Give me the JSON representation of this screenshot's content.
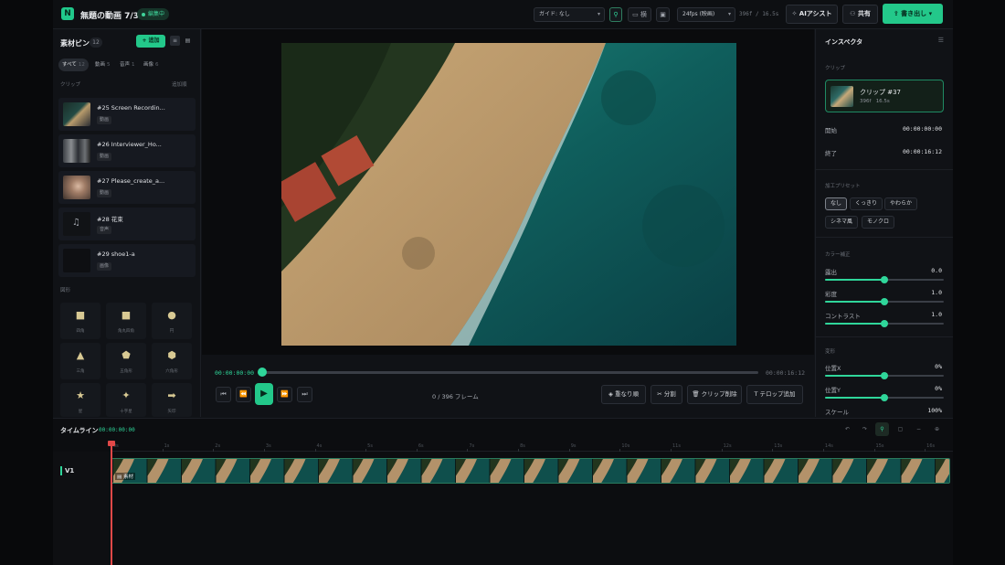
{
  "project": {
    "logo": "N",
    "title": "無題の動画 7/31",
    "status": "編集中"
  },
  "toolbar": {
    "guide_select": "ガイド: なし",
    "aspect_label": "横",
    "fps_select": "24fps (映画)",
    "frames_info": "396f / 16.5s",
    "ai_label": "AIアシスト",
    "share_label": "共有",
    "export_label": "書き出し"
  },
  "bin": {
    "title": "素材ビン",
    "count": "12",
    "add_label": "+ 追加",
    "tabs": [
      {
        "label": "すべて",
        "count": "12"
      },
      {
        "label": "動画",
        "count": "5"
      },
      {
        "label": "音声",
        "count": "1"
      },
      {
        "label": "画像",
        "count": "6"
      }
    ],
    "clips_label": "クリップ",
    "sort_label": "追加順",
    "clips": [
      {
        "name": "#25 Screen Recordin...",
        "type": "動画"
      },
      {
        "name": "#26 Interviewer_Ho...",
        "type": "動画"
      },
      {
        "name": "#27 Please_create_a...",
        "type": "動画"
      },
      {
        "name": "#28 花束",
        "type": "音声"
      },
      {
        "name": "#29 shoe1-a",
        "type": "画像"
      }
    ],
    "shapes_label": "図形",
    "shapes": [
      {
        "label": "四角",
        "icon": "square-icon"
      },
      {
        "label": "角丸四角",
        "icon": "rounded-square-icon"
      },
      {
        "label": "円",
        "icon": "circle-icon"
      },
      {
        "label": "三角",
        "icon": "triangle-icon"
      },
      {
        "label": "五角形",
        "icon": "pentagon-icon"
      },
      {
        "label": "六角形",
        "icon": "hexagon-icon"
      },
      {
        "label": "星",
        "icon": "star-icon"
      },
      {
        "label": "十字星",
        "icon": "sparkle-icon"
      },
      {
        "label": "矢印",
        "icon": "arrow-right-icon"
      }
    ]
  },
  "transport": {
    "current_tc": "00:00:00:00",
    "end_tc": "00:00:16:12",
    "frame_count": "0 / 396 フレーム",
    "overlap_label": "重なり順",
    "split_label": "分割",
    "delete_label": "クリップ削除",
    "caption_label": "テロップ追加"
  },
  "inspector": {
    "title": "インスペクタ",
    "clip_section": "クリップ",
    "clip_name": "クリップ #37",
    "clip_frames": "396f",
    "clip_duration": "16.5s",
    "start_label": "開始",
    "start_value": "00:00:00:00",
    "end_label": "終了",
    "end_value": "00:00:16:12",
    "preset_section": "加工プリセット",
    "presets": [
      "なし",
      "くっきり",
      "やわらか",
      "シネマ風",
      "モノクロ"
    ],
    "color_section": "カラー補正",
    "sliders": [
      {
        "label": "露出",
        "value": "0.0",
        "level": 0.5
      },
      {
        "label": "彩度",
        "value": "1.0",
        "level": 0.5
      },
      {
        "label": "コントラスト",
        "value": "1.0",
        "level": 0.5
      }
    ],
    "transform_section": "変形",
    "transform": [
      {
        "label": "位置X",
        "value": "0%",
        "level": 0.5
      },
      {
        "label": "位置Y",
        "value": "0%",
        "level": 0.5
      }
    ],
    "scale_label": "スケール",
    "scale_value": "100%"
  },
  "timeline": {
    "title": "タイムライン",
    "current_tc": "00:00:00:00",
    "ticks": [
      "0s",
      "1s",
      "2s",
      "3s",
      "4s",
      "5s",
      "6s",
      "7s",
      "8s",
      "9s",
      "10s",
      "11s",
      "12s",
      "13s",
      "14s",
      "15s",
      "16s"
    ],
    "track": "V1",
    "clip_label": "素材"
  },
  "colors": {
    "accent": "#23c88a",
    "playhead": "#e04848"
  }
}
